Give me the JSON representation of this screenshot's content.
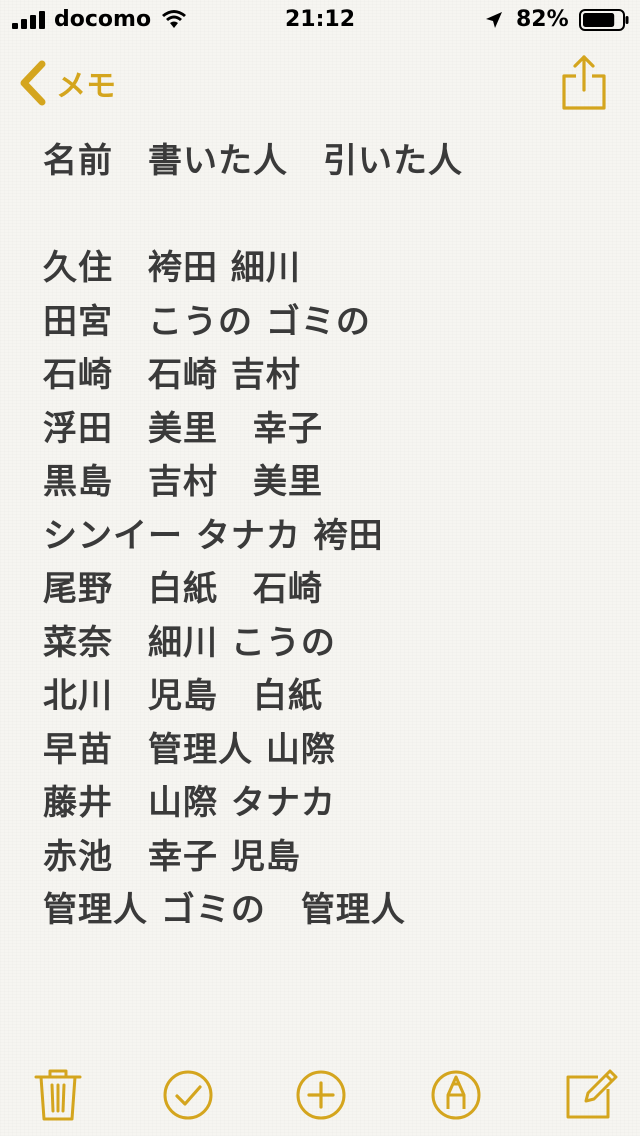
{
  "status_bar": {
    "carrier": "docomo",
    "time": "21:12",
    "battery_percent": "82%",
    "battery_level": 0.82
  },
  "nav": {
    "back_label": "メモ"
  },
  "note": {
    "lines": [
      "名前　書いた人　引いた人",
      "",
      "久住　袴田 細川",
      "田宮　こうの ゴミの",
      "石崎　石崎 吉村",
      "浮田　美里　幸子",
      "黒島　吉村　美里",
      "シンイー タナカ 袴田",
      "尾野　白紙　石崎",
      "菜奈　細川 こうの",
      "北川　児島　白紙",
      "早苗　管理人 山際",
      "藤井　山際 タナカ",
      "赤池　幸子 児島",
      "管理人 ゴミの　管理人"
    ]
  },
  "toolbar": {
    "icons": [
      "trash-icon",
      "checklist-icon",
      "add-icon",
      "markup-icon",
      "compose-icon"
    ]
  },
  "colors": {
    "accent": "#d4a51e",
    "text": "#3a3a3a",
    "background": "#f6f5f1"
  }
}
